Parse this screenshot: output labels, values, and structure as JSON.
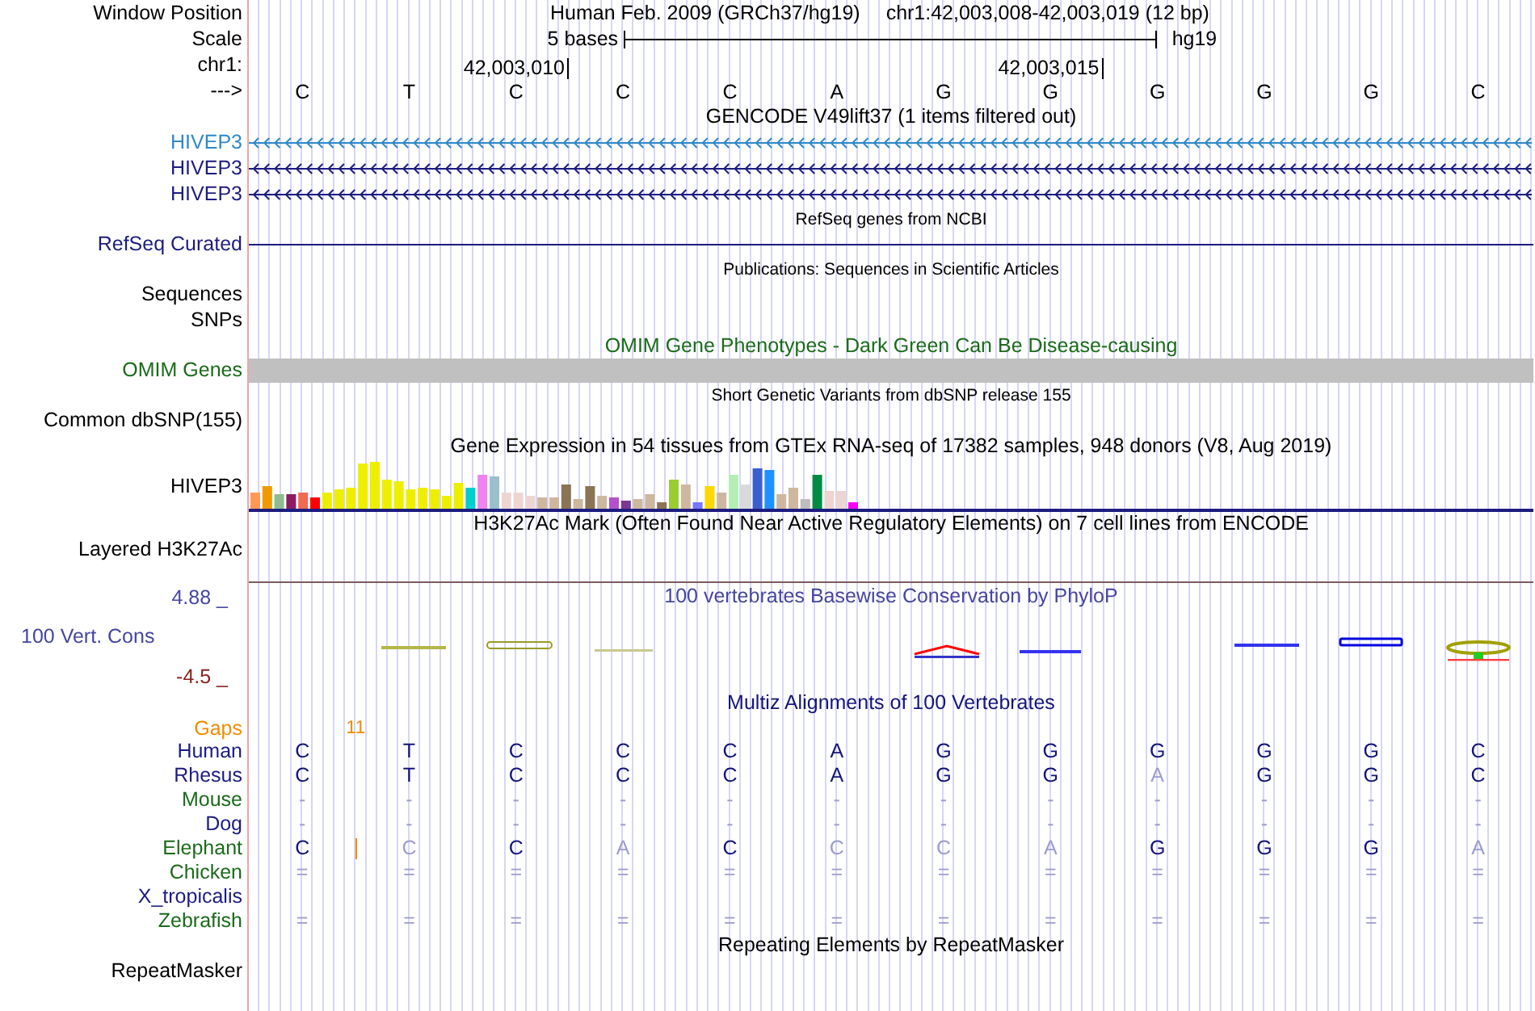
{
  "rows": [
    {
      "kind": "position",
      "label": "Window Position",
      "assembly": "Human Feb. 2009 (GRCh37/hg19)",
      "range": "chr1:42,003,008-42,003,019 (12 bp)"
    },
    {
      "kind": "scale",
      "label": "Scale",
      "span": "5 bases",
      "assembly": "hg19"
    },
    {
      "kind": "ruler",
      "label": "chr1:",
      "ticks": [
        "42,003,010",
        "42,003,015"
      ]
    },
    {
      "kind": "bases",
      "label": "--->",
      "letters": [
        "C",
        "T",
        "C",
        "C",
        "C",
        "A",
        "G",
        "G",
        "G",
        "G",
        "G",
        "C"
      ]
    },
    {
      "kind": "title",
      "text": "GENCODE V49lift37 (1 items filtered out)",
      "color": "#000000"
    },
    {
      "kind": "gene",
      "label": "HIVEP3",
      "color": "#2f88c8"
    },
    {
      "kind": "gene",
      "label": "HIVEP3",
      "color": "#1c1c80"
    },
    {
      "kind": "gene",
      "label": "HIVEP3",
      "color": "#1c1c80"
    },
    {
      "kind": "small_title",
      "text": "RefSeq genes from NCBI"
    },
    {
      "kind": "line",
      "label": "RefSeq Curated",
      "color": "#1c1c80"
    },
    {
      "kind": "small_title",
      "text": "Publications: Sequences in Scientific Articles"
    },
    {
      "kind": "empty",
      "label": "Sequences"
    },
    {
      "kind": "empty",
      "label": "SNPs"
    },
    {
      "kind": "title",
      "text": "OMIM Gene Phenotypes - Dark Green Can Be Disease-causing",
      "color": "#1a6b1a"
    },
    {
      "kind": "bar",
      "label": "OMIM Genes",
      "color": "#1a6b1a"
    },
    {
      "kind": "small_title",
      "text": "Short Genetic Variants from dbSNP release 155"
    },
    {
      "kind": "empty",
      "label": "Common dbSNP(155)"
    },
    {
      "kind": "title",
      "text": "Gene Expression in 54 tissues from GTEx RNA-seq of 17382 samples, 948 donors (V8, Aug 2019)",
      "color": "#000000"
    },
    {
      "kind": "expression",
      "label": "HIVEP3"
    },
    {
      "kind": "title",
      "text": "H3K27Ac Mark (Often Found Near Active Regulatory Elements) on 7 cell lines from ENCODE",
      "color": "#000000"
    },
    {
      "kind": "layered",
      "label": "Layered H3K27Ac"
    },
    {
      "kind": "conservation",
      "title": "100 vertebrates Basewise Conservation by PhyloP",
      "label": "100 Vert. Cons",
      "max": "4.88 _",
      "min": "-4.5 _"
    },
    {
      "kind": "title",
      "text": "Multiz Alignments of 100 Vertebrates",
      "color": "#14147a"
    },
    {
      "kind": "gaps",
      "label": "Gaps",
      "color": "#f08c00",
      "count": "11"
    },
    {
      "kind": "species",
      "label": "Human",
      "color": "#1c1c80",
      "cells": [
        {
          "text": "C",
          "faded": false
        },
        {
          "text": "T",
          "faded": false
        },
        {
          "text": "C",
          "faded": false
        },
        {
          "text": "C",
          "faded": false
        },
        {
          "text": "C",
          "faded": false
        },
        {
          "text": "A",
          "faded": false
        },
        {
          "text": "G",
          "faded": false
        },
        {
          "text": "G",
          "faded": false
        },
        {
          "text": "G",
          "faded": false
        },
        {
          "text": "G",
          "faded": false
        },
        {
          "text": "G",
          "faded": false
        },
        {
          "text": "C",
          "faded": false
        }
      ]
    },
    {
      "kind": "species",
      "label": "Rhesus",
      "color": "#1c1c80",
      "cells": [
        {
          "text": "C",
          "faded": false
        },
        {
          "text": "T",
          "faded": false
        },
        {
          "text": "C",
          "faded": false
        },
        {
          "text": "C",
          "faded": false
        },
        {
          "text": "C",
          "faded": false
        },
        {
          "text": "A",
          "faded": false
        },
        {
          "text": "G",
          "faded": false
        },
        {
          "text": "G",
          "faded": false
        },
        {
          "text": "A",
          "faded": true
        },
        {
          "text": "G",
          "faded": false
        },
        {
          "text": "G",
          "faded": false
        },
        {
          "text": "C",
          "faded": false
        }
      ]
    },
    {
      "kind": "species",
      "label": "Mouse",
      "color": "#1a6b1a",
      "cells": [
        {
          "text": "-",
          "faded": true
        },
        {
          "text": "-",
          "faded": true
        },
        {
          "text": "-",
          "faded": true
        },
        {
          "text": "-",
          "faded": true
        },
        {
          "text": "-",
          "faded": true
        },
        {
          "text": "-",
          "faded": true
        },
        {
          "text": "-",
          "faded": true
        },
        {
          "text": "-",
          "faded": true
        },
        {
          "text": "-",
          "faded": true
        },
        {
          "text": "-",
          "faded": true
        },
        {
          "text": "-",
          "faded": true
        },
        {
          "text": "-",
          "faded": true
        }
      ]
    },
    {
      "kind": "species",
      "label": "Dog",
      "color": "#1c1c80",
      "cells": [
        {
          "text": "-",
          "faded": true
        },
        {
          "text": "-",
          "faded": true
        },
        {
          "text": "-",
          "faded": true
        },
        {
          "text": "-",
          "faded": true
        },
        {
          "text": "-",
          "faded": true
        },
        {
          "text": "-",
          "faded": true
        },
        {
          "text": "-",
          "faded": true
        },
        {
          "text": "-",
          "faded": true
        },
        {
          "text": "-",
          "faded": true
        },
        {
          "text": "-",
          "faded": true
        },
        {
          "text": "-",
          "faded": true
        },
        {
          "text": "-",
          "faded": true
        }
      ]
    },
    {
      "kind": "species",
      "label": "Elephant",
      "color": "#1a6b1a",
      "cells": [
        {
          "text": "C",
          "faded": false,
          "insertion": true
        },
        {
          "text": "C",
          "faded": true
        },
        {
          "text": "C",
          "faded": false
        },
        {
          "text": "A",
          "faded": true
        },
        {
          "text": "C",
          "faded": false
        },
        {
          "text": "C",
          "faded": true
        },
        {
          "text": "C",
          "faded": true
        },
        {
          "text": "A",
          "faded": true
        },
        {
          "text": "G",
          "faded": false
        },
        {
          "text": "G",
          "faded": false
        },
        {
          "text": "G",
          "faded": false
        },
        {
          "text": "A",
          "faded": true
        }
      ]
    },
    {
      "kind": "species",
      "label": "Chicken",
      "color": "#1a6b1a",
      "cells": [
        {
          "text": "=",
          "faded": true
        },
        {
          "text": "=",
          "faded": true
        },
        {
          "text": "=",
          "faded": true
        },
        {
          "text": "=",
          "faded": true
        },
        {
          "text": "=",
          "faded": true
        },
        {
          "text": "=",
          "faded": true
        },
        {
          "text": "=",
          "faded": true
        },
        {
          "text": "=",
          "faded": true
        },
        {
          "text": "=",
          "faded": true
        },
        {
          "text": "=",
          "faded": true
        },
        {
          "text": "=",
          "faded": true
        },
        {
          "text": "=",
          "faded": true
        }
      ]
    },
    {
      "kind": "species",
      "label": "X_tropicalis",
      "color": "#1c1c80"
    },
    {
      "kind": "species",
      "label": "Zebrafish",
      "color": "#1a6b1a",
      "cells": [
        {
          "text": "=",
          "faded": true
        },
        {
          "text": "=",
          "faded": true
        },
        {
          "text": "=",
          "faded": true
        },
        {
          "text": "=",
          "faded": true
        },
        {
          "text": "=",
          "faded": true
        },
        {
          "text": "=",
          "faded": true
        },
        {
          "text": "=",
          "faded": true
        },
        {
          "text": "=",
          "faded": true
        },
        {
          "text": "=",
          "faded": true
        },
        {
          "text": "=",
          "faded": true
        },
        {
          "text": "=",
          "faded": true
        },
        {
          "text": "=",
          "faded": true
        }
      ]
    },
    {
      "kind": "title",
      "text": "Repeating Elements by RepeatMasker",
      "color": "#000000"
    },
    {
      "kind": "empty",
      "label": "RepeatMasker"
    }
  ]
}
